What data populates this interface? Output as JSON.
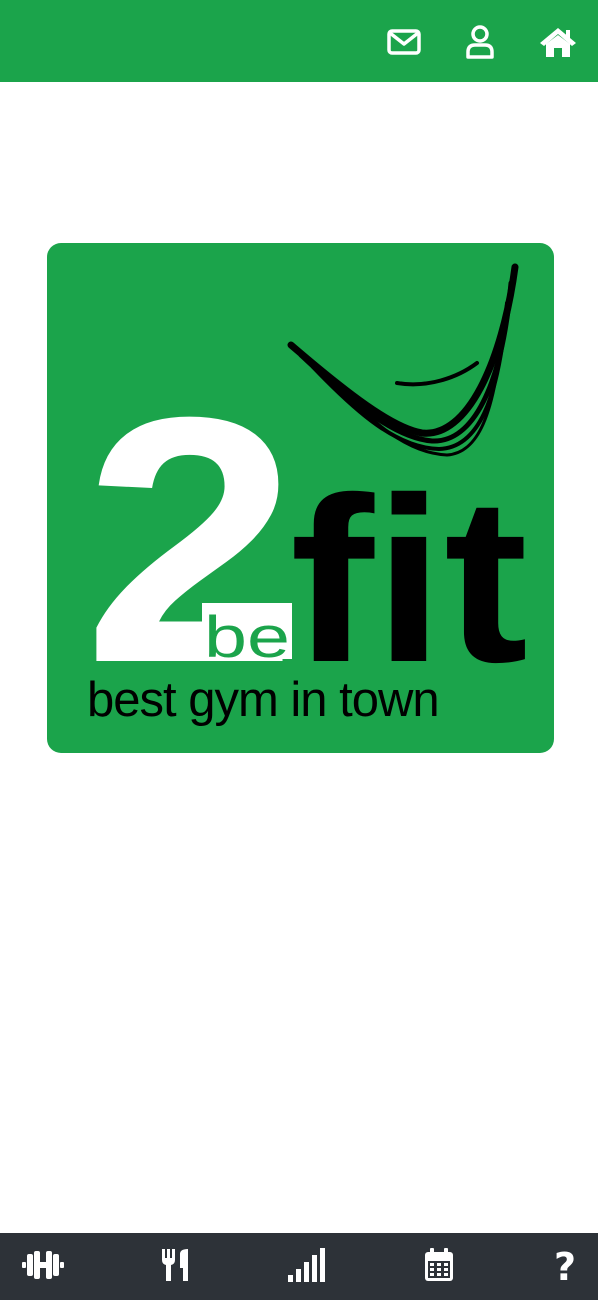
{
  "header": {
    "icons": [
      "envelope-icon",
      "user-icon",
      "home-icon"
    ]
  },
  "logo": {
    "number": "2",
    "small_word": "be",
    "big_word": "fit",
    "tagline": "best gym in town",
    "brand_color": "#1ba44b"
  },
  "bottom_nav": {
    "icons": [
      "dumbbell-icon",
      "fork-knife-icon",
      "signal-bars-icon",
      "calendar-icon",
      "question-icon"
    ],
    "help_glyph": "?"
  },
  "colors": {
    "top_bar": "#1ba44b",
    "bottom_bar": "#2d3238",
    "icon": "#ffffff"
  }
}
